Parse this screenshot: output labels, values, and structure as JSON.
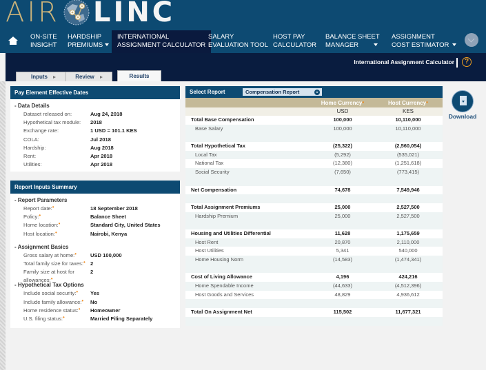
{
  "brand": {
    "part1": "AIR",
    "part2": "LINC"
  },
  "nav": {
    "items": [
      {
        "line1": "ON-SITE",
        "line2": "INSIGHT",
        "dropdown": false,
        "active": false
      },
      {
        "line1": "HARDSHIP",
        "line2": "PREMIUMS",
        "dropdown": true,
        "active": false
      },
      {
        "line1": "INTERNATIONAL",
        "line2": "ASSIGNMENT CALCULATOR",
        "dropdown": false,
        "active": true
      },
      {
        "line1": "SALARY",
        "line2": "EVALUATION TOOL",
        "dropdown": false,
        "active": false
      },
      {
        "line1": "HOST PAY",
        "line2": "CALCULATOR",
        "dropdown": false,
        "active": false
      },
      {
        "line1": "BALANCE SHEET",
        "line2": "MANAGER",
        "dropdown": true,
        "active": false
      },
      {
        "line1": "ASSIGNMENT",
        "line2": "COST ESTIMATOR",
        "dropdown": true,
        "active": false
      }
    ]
  },
  "subbar": {
    "title": "International Assignment Calculator",
    "help": "?"
  },
  "tabs": [
    {
      "label": "Inputs",
      "arrow": true
    },
    {
      "label": "Review",
      "arrow": true
    },
    {
      "label": "Results",
      "arrow": false,
      "active": true
    }
  ],
  "effective_dates": {
    "title": "Pay Element Effective Dates",
    "section": "Data Details",
    "rows": [
      {
        "label": "Dataset released on:",
        "value": "Aug 24, 2018"
      },
      {
        "label": "Hypothetical tax module:",
        "value": "2018"
      },
      {
        "label": "Exchange rate:",
        "value": "1 USD = 101.1 KES"
      },
      {
        "label": "COLA:",
        "value": "Jul 2018"
      },
      {
        "label": "Hardship:",
        "value": "Aug 2018"
      },
      {
        "label": "Rent:",
        "value": "Apr 2018"
      },
      {
        "label": "Utilities:",
        "value": "Apr 2018"
      }
    ]
  },
  "inputs_summary": {
    "title": "Report Inputs Summary",
    "sections": [
      {
        "title": "Report Parameters",
        "rows": [
          {
            "label": "Report date:",
            "value": "18 September 2018"
          },
          {
            "label": "Policy:",
            "value": "Balance Sheet"
          },
          {
            "label": "Home location:",
            "value": "Standard City, United States"
          },
          {
            "label": "Host location:",
            "value": "Nairobi, Kenya"
          }
        ]
      },
      {
        "title": "Assignment Basics",
        "rows": [
          {
            "label": "Gross salary at home:",
            "value": "USD 100,000"
          },
          {
            "label": "Total family size for taxes:",
            "value": "2"
          },
          {
            "label": "Family size at host for allowances:",
            "value": "2"
          }
        ]
      },
      {
        "title": "Hypothetical Tax Options",
        "rows": [
          {
            "label": "Include social security:",
            "value": "Yes"
          },
          {
            "label": "Include family allowance:",
            "value": "No"
          },
          {
            "label": "Home residence status:",
            "value": "Homeowner"
          },
          {
            "label": "U.S. filing status:",
            "value": "Married Filing Separately"
          }
        ]
      }
    ]
  },
  "report": {
    "select_label": "Select Report",
    "selected": "Compensation Report",
    "home_currency_label": "Home Currency",
    "host_currency_label": "Host Currency",
    "home_code": "USD",
    "host_code": "KES",
    "rows": [
      {
        "type": "bold",
        "label": "Total Base Compensation",
        "home": "100,000",
        "host": "10,110,000"
      },
      {
        "type": "sub",
        "label": "Base Salary",
        "home": "100,000",
        "host": "10,110,000"
      },
      {
        "type": "spacer"
      },
      {
        "type": "bold",
        "label": "Total Hypothetical Tax",
        "home": "(25,322)",
        "host": "(2,560,054)"
      },
      {
        "type": "sub",
        "label": "Local Tax",
        "home": "(5,292)",
        "host": "(535,021)"
      },
      {
        "type": "sub",
        "label": "National Tax",
        "home": "(12,380)",
        "host": "(1,251,618)"
      },
      {
        "type": "sub",
        "label": "Social Security",
        "home": "(7,650)",
        "host": "(773,415)"
      },
      {
        "type": "spacer"
      },
      {
        "type": "bold",
        "label": "Net Compensation",
        "home": "74,678",
        "host": "7,549,946"
      },
      {
        "type": "spacer"
      },
      {
        "type": "bold",
        "label": "Total Assignment Premiums",
        "home": "25,000",
        "host": "2,527,500"
      },
      {
        "type": "sub",
        "label": "Hardship Premium",
        "home": "25,000",
        "host": "2,527,500"
      },
      {
        "type": "spacer"
      },
      {
        "type": "bold",
        "label": "Housing and Utilities Differential",
        "home": "11,628",
        "host": "1,175,659"
      },
      {
        "type": "sub",
        "label": "Host Rent",
        "home": "20,870",
        "host": "2,110,000"
      },
      {
        "type": "sub",
        "label": "Host Utilities",
        "home": "5,341",
        "host": "540,000"
      },
      {
        "type": "sub",
        "label": "Home Housing Norm",
        "home": "(14,583)",
        "host": "(1,474,341)"
      },
      {
        "type": "spacer"
      },
      {
        "type": "bold",
        "label": "Cost of Living Allowance",
        "home": "4,196",
        "host": "424,216"
      },
      {
        "type": "sub",
        "label": "Home Spendable Income",
        "home": "(44,633)",
        "host": "(4,512,396)"
      },
      {
        "type": "sub",
        "label": "Host Goods and Services",
        "home": "48,829",
        "host": "4,936,612"
      },
      {
        "type": "spacer"
      },
      {
        "type": "bold",
        "label": "Total On Assignment Net",
        "home": "115,502",
        "host": "11,677,321"
      },
      {
        "type": "spacer"
      }
    ]
  },
  "download": {
    "label": "Download"
  },
  "colors": {
    "navy": "#0d4a72",
    "dark_navy": "#091c3f",
    "tan": "#c4b998",
    "accent_orange": "#f08a1c"
  }
}
